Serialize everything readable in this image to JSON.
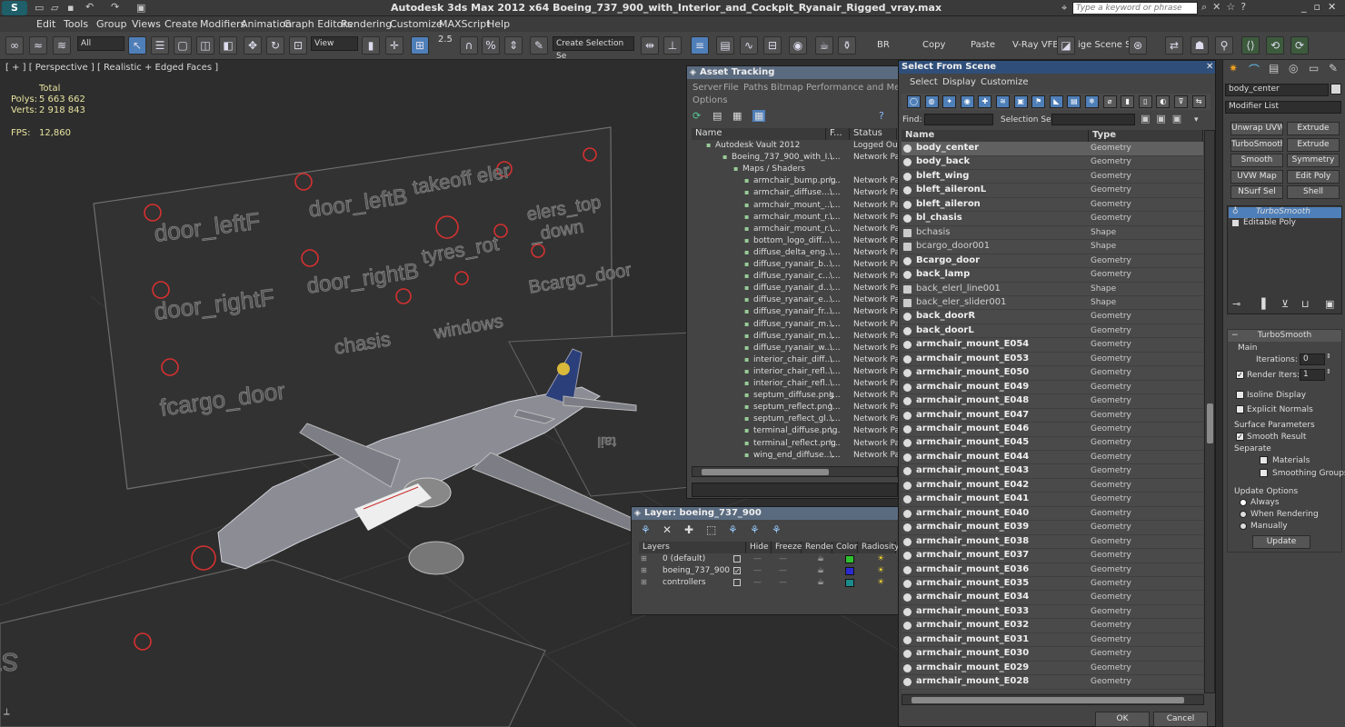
{
  "window": {
    "title": "Autodesk 3ds Max  2012 x64      Boeing_737_900_with_Interior_and_Cockpit_Ryanair_Rigged_vray.max",
    "search_placeholder": "Type a keyword or phrase"
  },
  "menu": [
    "Edit",
    "Tools",
    "Group",
    "Views",
    "Create",
    "Modifiers",
    "Animation",
    "Graph Editors",
    "Rendering",
    "Customize",
    "MAXScript",
    "Help"
  ],
  "toolbar": {
    "filter": "All",
    "refcoord": "View",
    "angle": "2.5",
    "selset": "Create Selection Se",
    "labels": [
      "BR",
      "Copy",
      "Paste",
      "V-Ray VFB",
      "ige Scene Stat"
    ]
  },
  "viewport": {
    "label": "[ + ] [ Perspective ] [ Realistic + Edged Faces ]",
    "stats": {
      "total_label": "Total",
      "polys_label": "Polys:",
      "polys": "5 663 662",
      "verts_label": "Verts:",
      "verts": "2 918 843",
      "fps_label": "FPS:",
      "fps": "12,860"
    },
    "rig_labels": [
      "door_leftF",
      "door_leftB",
      "takeoff eler",
      "elers_top _down",
      "door_rightF",
      "door_rightB",
      "tyres_rot",
      "Bcargo_door",
      "chasis",
      "windows",
      "fcargo_door",
      "steering",
      "tail"
    ]
  },
  "asset_tracking": {
    "title": "Asset Tracking",
    "menu": [
      "Server",
      "File",
      "Paths",
      "Bitmap Performance and Memory",
      "Options"
    ],
    "headers": [
      "Name",
      "F...",
      "Status"
    ],
    "vault": {
      "name": "Autodesk Vault 2012",
      "status": "Logged Out ("
    },
    "file": {
      "name": "Boeing_737_900_with_I...",
      "f": "\\...",
      "status": "Network Path"
    },
    "maps_label": "Maps / Shaders",
    "maps": [
      "armchair_bump.png",
      "armchair_diffuse....",
      "armchair_mount_...",
      "armchair_mount_r...",
      "armchair_mount_r...",
      "bottom_logo_diff...",
      "diffuse_delta_eng...",
      "diffuse_ryanair_b...",
      "diffuse_ryanair_c...",
      "diffuse_ryanair_d...",
      "diffuse_ryanair_e...",
      "diffuse_ryanair_fr...",
      "diffuse_ryanair_m...",
      "diffuse_ryanair_m...",
      "diffuse_ryanair_w...",
      "interior_chair_diff...",
      "interior_chair_refl...",
      "interior_chair_refl...",
      "septum_diffuse.png",
      "septum_reflect.png",
      "septum_reflect_gl...",
      "terminal_diffuse.png",
      "terminal_reflect.png",
      "wing_end_diffuse...."
    ],
    "map_f": "\\...",
    "map_status": "Network Path"
  },
  "layer": {
    "title": "Layer: boeing_737_900",
    "headers": [
      "Layers",
      "Hide",
      "Freeze",
      "Render",
      "Color",
      "Radiosity"
    ],
    "rows": [
      {
        "name": "0 (default)",
        "color": "#2fbf2f"
      },
      {
        "name": "boeing_737_900",
        "color": "#2a2ad0"
      },
      {
        "name": "controllers",
        "color": "#1c8a8a"
      }
    ]
  },
  "select_scene": {
    "title": "Select From Scene",
    "menu": [
      "Select",
      "Display",
      "Customize"
    ],
    "find_label": "Find:",
    "selset_label": "Selection Set:",
    "headers": [
      "Name",
      "Type"
    ],
    "rows": [
      {
        "n": "body_center",
        "t": "Geometry"
      },
      {
        "n": "body_back",
        "t": "Geometry"
      },
      {
        "n": "bleft_wing",
        "t": "Geometry"
      },
      {
        "n": "bleft_aileronL",
        "t": "Geometry"
      },
      {
        "n": "bleft_aileron",
        "t": "Geometry"
      },
      {
        "n": "bl_chasis",
        "t": "Geometry"
      },
      {
        "n": "bchasis",
        "t": "Shape"
      },
      {
        "n": "bcargo_door001",
        "t": "Shape"
      },
      {
        "n": "Bcargo_door",
        "t": "Geometry"
      },
      {
        "n": "back_lamp",
        "t": "Geometry"
      },
      {
        "n": "back_elerl_line001",
        "t": "Shape"
      },
      {
        "n": "back_eler_slider001",
        "t": "Shape"
      },
      {
        "n": "back_doorR",
        "t": "Geometry"
      },
      {
        "n": "back_doorL",
        "t": "Geometry"
      },
      {
        "n": "armchair_mount_E054",
        "t": "Geometry"
      },
      {
        "n": "armchair_mount_E053",
        "t": "Geometry"
      },
      {
        "n": "armchair_mount_E050",
        "t": "Geometry"
      },
      {
        "n": "armchair_mount_E049",
        "t": "Geometry"
      },
      {
        "n": "armchair_mount_E048",
        "t": "Geometry"
      },
      {
        "n": "armchair_mount_E047",
        "t": "Geometry"
      },
      {
        "n": "armchair_mount_E046",
        "t": "Geometry"
      },
      {
        "n": "armchair_mount_E045",
        "t": "Geometry"
      },
      {
        "n": "armchair_mount_E044",
        "t": "Geometry"
      },
      {
        "n": "armchair_mount_E043",
        "t": "Geometry"
      },
      {
        "n": "armchair_mount_E042",
        "t": "Geometry"
      },
      {
        "n": "armchair_mount_E041",
        "t": "Geometry"
      },
      {
        "n": "armchair_mount_E040",
        "t": "Geometry"
      },
      {
        "n": "armchair_mount_E039",
        "t": "Geometry"
      },
      {
        "n": "armchair_mount_E038",
        "t": "Geometry"
      },
      {
        "n": "armchair_mount_E037",
        "t": "Geometry"
      },
      {
        "n": "armchair_mount_E036",
        "t": "Geometry"
      },
      {
        "n": "armchair_mount_E035",
        "t": "Geometry"
      },
      {
        "n": "armchair_mount_E034",
        "t": "Geometry"
      },
      {
        "n": "armchair_mount_E033",
        "t": "Geometry"
      },
      {
        "n": "armchair_mount_E032",
        "t": "Geometry"
      },
      {
        "n": "armchair_mount_E031",
        "t": "Geometry"
      },
      {
        "n": "armchair_mount_E030",
        "t": "Geometry"
      },
      {
        "n": "armchair_mount_E029",
        "t": "Geometry"
      },
      {
        "n": "armchair_mount_E028",
        "t": "Geometry"
      }
    ],
    "ok": "OK",
    "cancel": "Cancel"
  },
  "command_panel": {
    "object_name": "body_center",
    "modifier_list": "Modifier List",
    "buttons": [
      "Unwrap UVW",
      "Extrude",
      "TurboSmooth",
      "Extrude",
      "Smooth",
      "Symmetry",
      "UVW Map",
      "Edit Poly",
      "NSurf Sel",
      "Shell"
    ],
    "stack": [
      "TurboSmooth",
      "Editable Poly"
    ],
    "rollout": "TurboSmooth",
    "main": "Main",
    "iterations_label": "Iterations:",
    "iterations": "0",
    "render_iters_label": "Render Iters:",
    "render_iters": "1",
    "isoline": "Isoline Display",
    "explicit": "Explicit Normals",
    "surface": "Surface Parameters",
    "smooth_result": "Smooth Result",
    "separate": "Separate",
    "materials": "Materials",
    "smoothing_groups": "Smoothing Groups",
    "update_options": "Update Options",
    "always": "Always",
    "when_rendering": "When Rendering",
    "manually": "Manually",
    "update": "Update"
  }
}
